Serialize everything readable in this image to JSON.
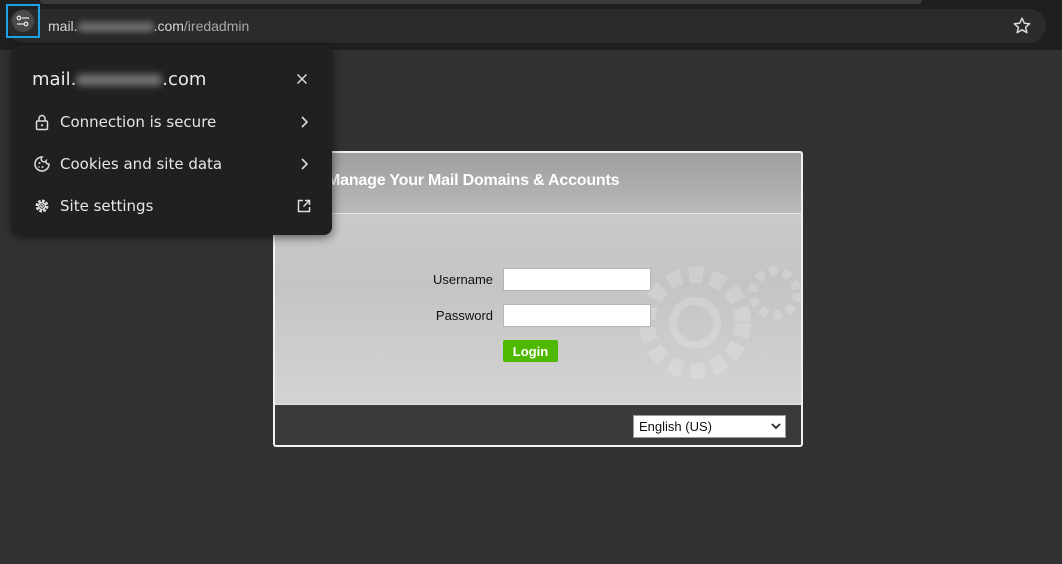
{
  "browser": {
    "url": {
      "prefix": "mail.",
      "suffix": ".com",
      "path": "/iredadmin"
    },
    "icons": {
      "site_info": "tune-icon",
      "bookmark": "star-icon"
    },
    "accent_color": "#1da1e8"
  },
  "site_popup": {
    "title_prefix": "mail.",
    "title_suffix": ".com",
    "items": [
      {
        "label": "Connection is secure",
        "icon": "lock-icon",
        "trailing": "chevron-right-icon"
      },
      {
        "label": "Cookies and site data",
        "icon": "cookie-icon",
        "trailing": "chevron-right-icon"
      },
      {
        "label": "Site settings",
        "icon": "gear-icon",
        "trailing": "external-link-icon"
      }
    ]
  },
  "login": {
    "header_title": "n To Manage Your Mail Domains & Accounts",
    "username_label": "Username",
    "password_label": "Password",
    "username_value": "",
    "password_value": "",
    "login_button": "Login",
    "language": "English (US)",
    "button_color": "#4fb800"
  }
}
